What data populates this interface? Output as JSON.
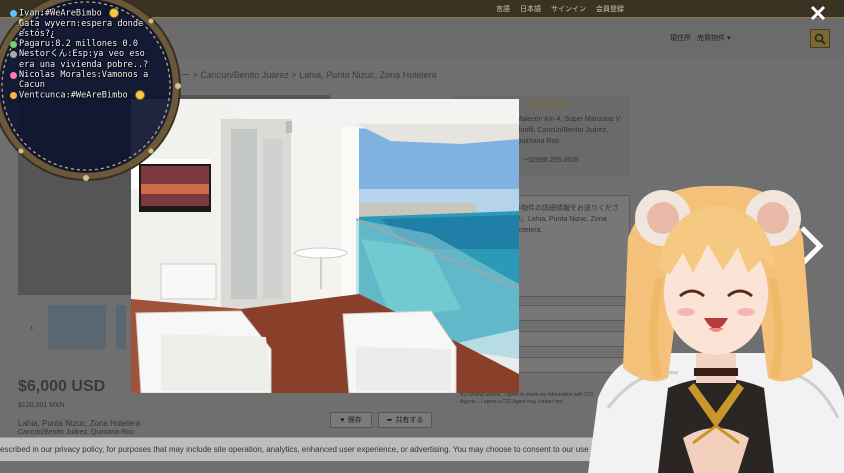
{
  "top_links": [
    "言語",
    "日本語",
    "サインイン",
    "会員登録"
  ],
  "header": {
    "filter_label": "現住所",
    "filter_value": "売買物件"
  },
  "breadcrumb": "ロー > Cancún/Benito Juárez > Lahia, Punta Nizuc, Zona Hotelera",
  "listing": {
    "price": "$6,000 USD",
    "price_sub": "$120,201 MXN",
    "address": "Lahia, Punta Nizuc, Zona Hotelera",
    "address_sub": "Cancún/Benito Juárez, Quintana Roo",
    "save_label": "保存",
    "share_label": "共有する"
  },
  "agent": {
    "name": "Elite Advisors",
    "address": "Malecón Kin 4, Super Manzana V Bonfil, Cancún/Benito Juárez, Quintana Roo",
    "phone": "+52998.295.3505"
  },
  "message": {
    "text": "の物件の詳細情報をお送りください。Lahia, Punta Nizuc, Zona Hotelera.",
    "terms": "By clicking Submit, I agree to share my information with C21 Agents... I agree a C21 Agent may contact me."
  },
  "cookie_text": "escribed in our privacy policy, for purposes that may include site operation, analytics, enhanced user experience, or advertising. You may choose to consent to our use of th",
  "lightbox": {
    "close_icon": "close-icon",
    "next_icon": "chevron-right-icon"
  },
  "chat": {
    "messages": [
      {
        "user": "Ivan",
        "text": ":#WeAreBimbo",
        "color": "#5cc1ff",
        "emoji": true
      },
      {
        "user": "Gata wyvern",
        "text": ":espera donde estós?¿",
        "color": "#c9a0ff",
        "emoji": false
      },
      {
        "user": "Pagaru",
        "text": ":8.2 millones 0.0",
        "color": "#6fd36f",
        "emoji": false
      },
      {
        "user": "Nestorくん",
        "text": ":Esp:ya veo eso era una vivienda pobre..?",
        "color": "#aaaaaa",
        "emoji": false
      },
      {
        "user": "Nicolas Morales",
        "text": ":Vamonos a Cacun",
        "color": "#ff7ab0",
        "emoji": false
      },
      {
        "user": "Ventcunca",
        "text": ":#WeAreBimbo",
        "color": "#ffb347",
        "emoji": true
      }
    ]
  }
}
